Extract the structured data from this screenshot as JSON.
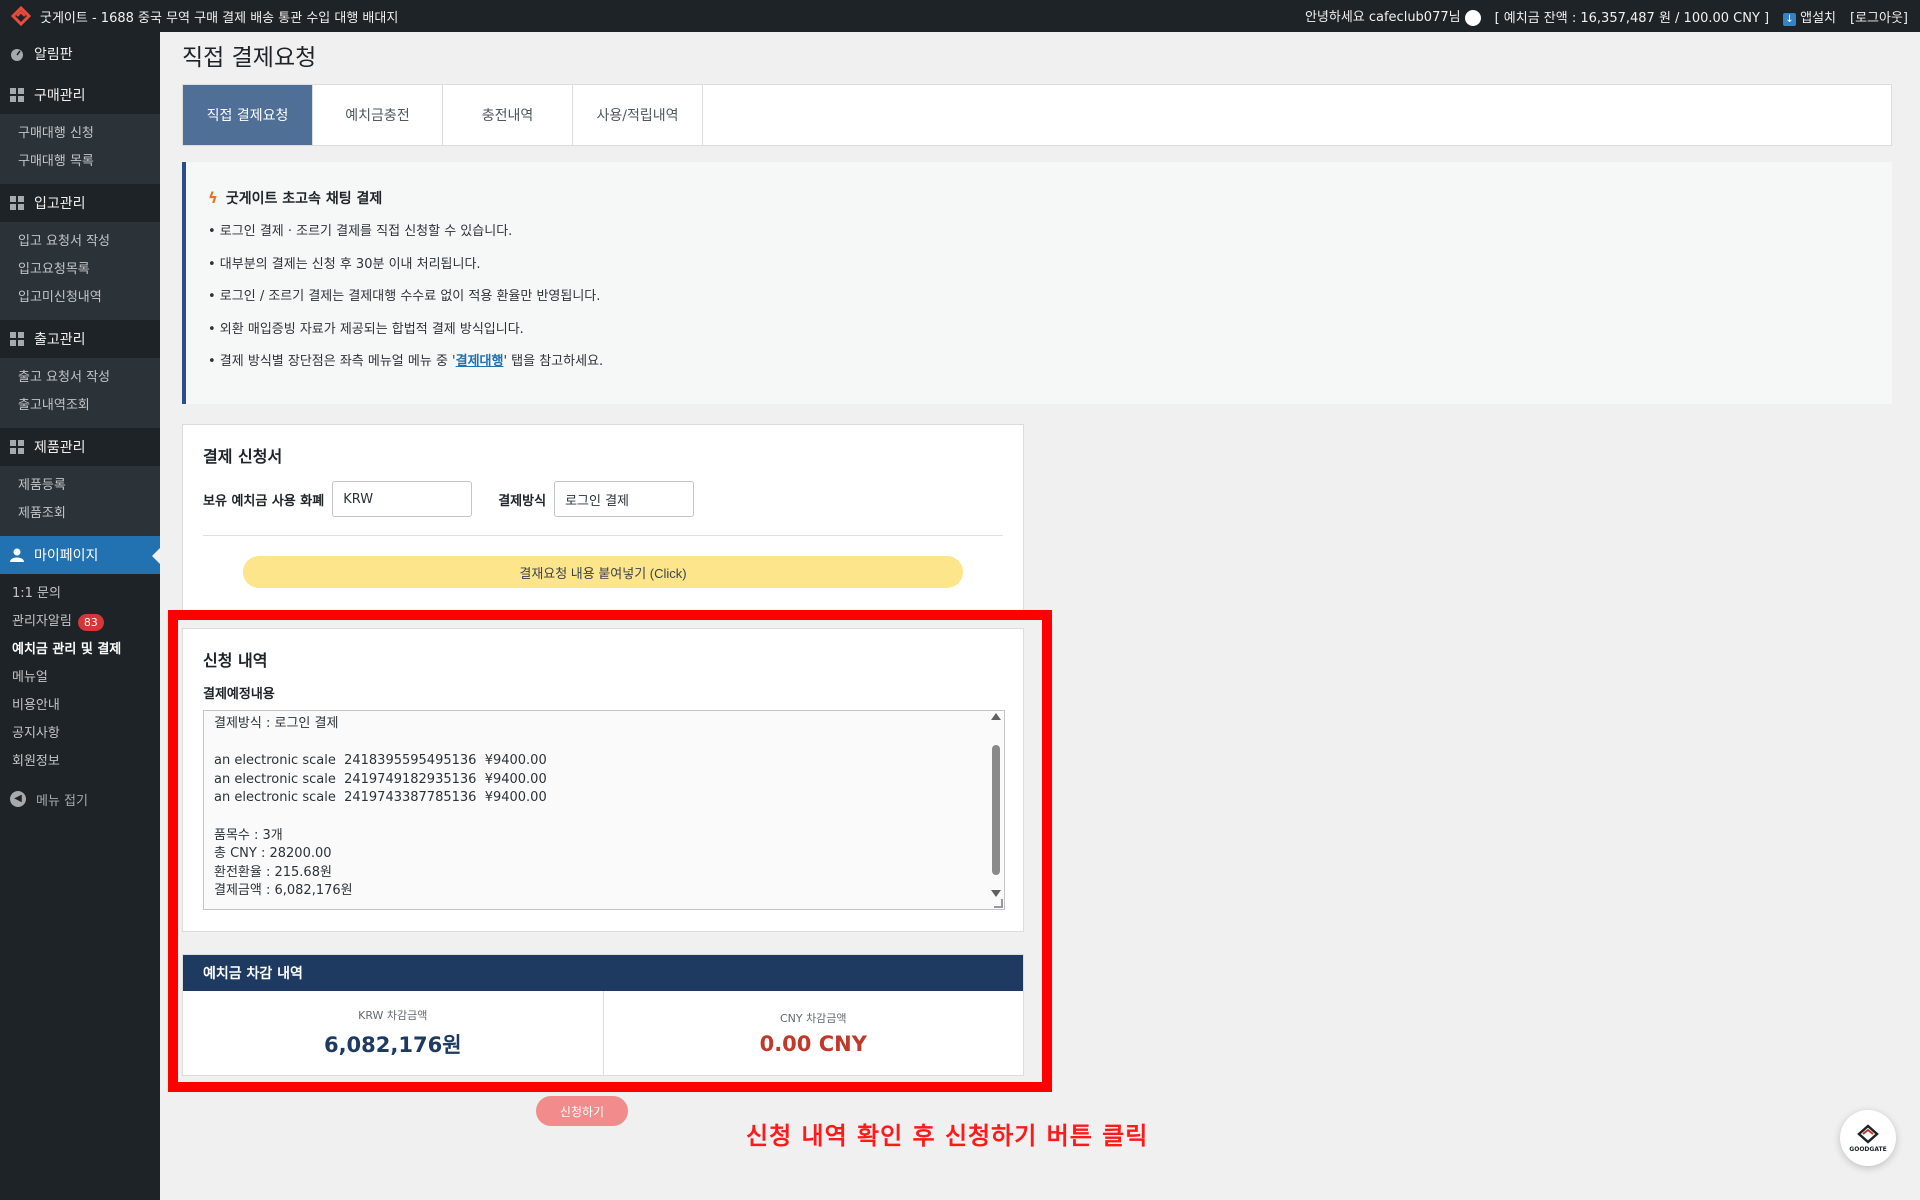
{
  "topbar": {
    "site_title": "굿게이트 - 1688 중국 무역 구매 결제 배송 통관 수입 대행 배대지",
    "greeting": "안녕하세요 cafeclub077님",
    "balance": "[ 예치금 잔액 : 16,357,487 원 / 100.00 CNY ]",
    "app_install": "앱설치",
    "logout": "[로그아웃]"
  },
  "sidebar": {
    "dashboard": "알림판",
    "purchase": {
      "title": "구매관리",
      "items": [
        "구매대행 신청",
        "구매대행 목록"
      ]
    },
    "inbound": {
      "title": "입고관리",
      "items": [
        "입고 요청서 작성",
        "입고요청목록",
        "입고미신청내역"
      ]
    },
    "outbound": {
      "title": "출고관리",
      "items": [
        "출고 요청서 작성",
        "출고내역조회"
      ]
    },
    "products": {
      "title": "제품관리",
      "items": [
        "제품등록",
        "제품조회"
      ]
    },
    "mypage": {
      "title": "마이페이지",
      "items": [
        "1:1 문의",
        "관리자알림",
        "예치금 관리 및 결제",
        "메뉴얼",
        "비용안내",
        "공지사항",
        "회원정보"
      ],
      "alert_count": "83"
    },
    "collapse": "메뉴 접기"
  },
  "page": {
    "title": "직접 결제요청",
    "tabs": [
      "직접 결제요청",
      "예치금충전",
      "충전내역",
      "사용/적립내역"
    ]
  },
  "notice": {
    "title": "굿게이트 초고속 채팅 결제",
    "lines": [
      "• 로그인 결제 · 조르기 결제를 직접 신청할 수 있습니다.",
      "• 대부분의 결제는 신청 후 30분 이내 처리됩니다.",
      "• 로그인 / 조르기 결제는 결제대행 수수료 없이 적용 환율만 반영됩니다.",
      "• 외환 매입증빙 자료가 제공되는 합법적 결제 방식입니다."
    ],
    "last_pre": "• 결제 방식별 장단점은 좌측 메뉴얼 메뉴 중 '",
    "last_link": "결제대행",
    "last_post": "' 탭을 참고하세요."
  },
  "form": {
    "title": "결제 신청서",
    "currency_label": "보유 예치금 사용 화폐",
    "currency_value": "KRW",
    "method_label": "결제방식",
    "method_value": "로그인 결제",
    "paste_button": "결재요청 내용 붙여넣기 (Click)"
  },
  "detail": {
    "title": "신청 내역",
    "sub_label": "결제예정내용",
    "lines": [
      "결제방식 : 로그인 결제",
      "",
      "an electronic scale  2418395595495136  ¥9400.00",
      "an electronic scale  2419749182935136  ¥9400.00",
      "an electronic scale  2419743387785136  ¥9400.00",
      "",
      "품목수 : 3개",
      "총 CNY : 28200.00",
      "환전환율 : 215.68원",
      "결제금액 : 6,082,176원"
    ]
  },
  "deduction": {
    "title": "예치금 차감 내역",
    "krw_label": "KRW 차감금액",
    "krw_value": "6,082,176원",
    "cny_label": "CNY 차감금액",
    "cny_value": "0.00 CNY"
  },
  "submit_button": "신청하기",
  "instruction": "신청 내역 확인 후 신청하기 버튼 클릭",
  "float_logo_text": "GOODGATE",
  "colors": {
    "admin_dark": "#1d2327",
    "accent_blue": "#2271b1",
    "tab_active": "#4f6f96",
    "navy": "#1f3a60",
    "highlight_red": "#ff0000",
    "paste_yellow": "#fde58c",
    "submit_pink": "#f28b8b"
  }
}
